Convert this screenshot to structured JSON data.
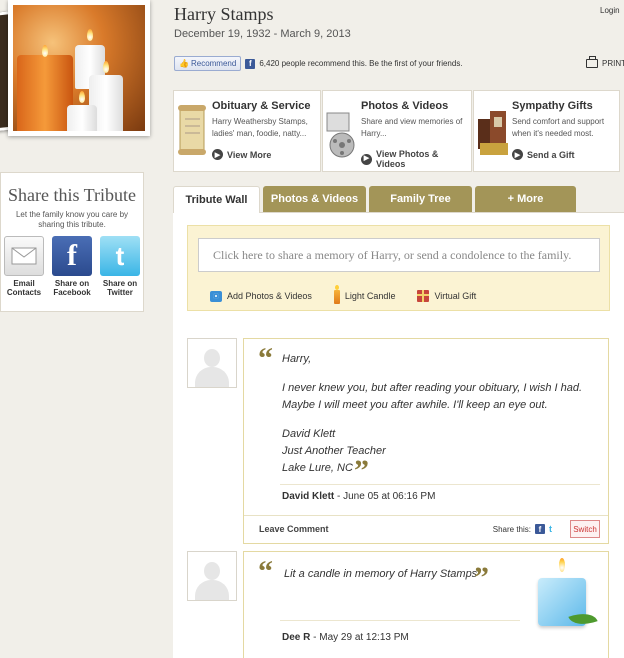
{
  "header": {
    "name": "Harry Stamps",
    "dates": "December 19, 1932 - March 9, 2013",
    "login": "Login",
    "recommend_button": "Recommend",
    "recommend_text": "6,420 people recommend this. Be the first of your friends.",
    "print": "PRINT"
  },
  "share": {
    "title": "Share this Tribute",
    "subtitle": "Let the family know you care by sharing this tribute.",
    "items": [
      {
        "label": "Email Contacts",
        "icon": "email-icon"
      },
      {
        "label": "Share on Facebook",
        "icon": "facebook-icon"
      },
      {
        "label": "Share on Twitter",
        "icon": "twitter-icon"
      }
    ]
  },
  "cards": [
    {
      "title": "Obituary & Service",
      "desc": "Harry Weathersby Stamps, ladies' man, foodie, natty...",
      "link": "View More"
    },
    {
      "title": "Photos & Videos",
      "desc": "Share and view memories of Harry...",
      "link": "View Photos & Videos"
    },
    {
      "title": "Sympathy Gifts",
      "desc": "Send comfort and support when it's needed most.",
      "link": "Send a Gift"
    }
  ],
  "tabs": [
    {
      "label": "Tribute Wall",
      "active": true
    },
    {
      "label": "Photos & Videos",
      "active": false
    },
    {
      "label": "Family Tree",
      "active": false
    },
    {
      "label": "+ More",
      "active": false
    }
  ],
  "compose": {
    "placeholder": "Click here to share a memory of Harry, or send a condolence to the family.",
    "actions": [
      "Add Photos & Videos",
      "Light Candle",
      "Virtual Gift"
    ]
  },
  "posts": [
    {
      "greeting": "Harry,",
      "body_line1": "I never knew you, but after reading your obituary, I wish I had.",
      "body_line2": "Maybe I will meet you after awhile. I'll keep an eye out.",
      "sig1": "David Klett",
      "sig2": "Just Another Teacher",
      "sig3": "Lake Lure, NC",
      "author": "David Klett",
      "date": " - June 05 at 06:16 PM",
      "leave_comment": "Leave Comment",
      "share_this": "Share this:",
      "switch": "Switch"
    },
    {
      "text": "Lit a candle in memory of Harry Stamps",
      "author": "Dee R",
      "date": " - May 29 at 12:13 PM"
    }
  ]
}
